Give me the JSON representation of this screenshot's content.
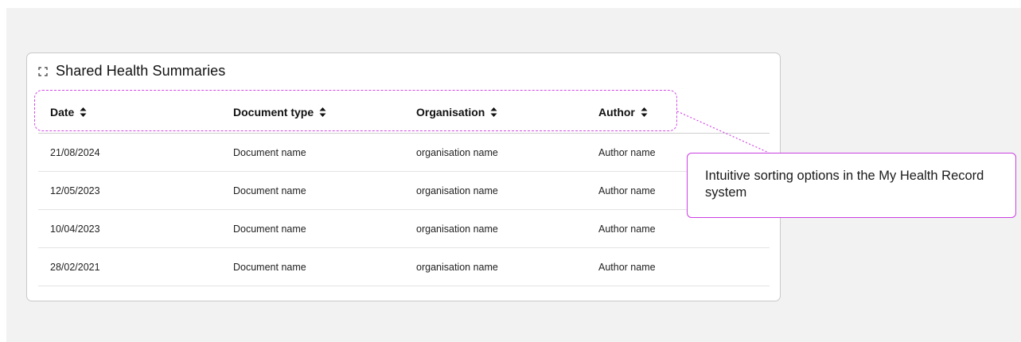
{
  "card": {
    "title": "Shared Health Summaries",
    "icon": "expand-icon"
  },
  "table": {
    "headers": [
      {
        "label": "Date",
        "icon": "sort-icon"
      },
      {
        "label": "Document type",
        "icon": "sort-icon"
      },
      {
        "label": "Organisation",
        "icon": "sort-icon"
      },
      {
        "label": "Author",
        "icon": "sort-icon"
      }
    ],
    "rows": [
      [
        "21/08/2024",
        "Document name",
        "organisation name",
        "Author name"
      ],
      [
        "12/05/2023",
        "Document name",
        "organisation name",
        "Author name"
      ],
      [
        "10/04/2023",
        "Document name",
        "organisation name",
        "Author name"
      ],
      [
        "28/02/2021",
        "Document name",
        "organisation name",
        "Author name"
      ]
    ]
  },
  "annotation": {
    "text": "Intuitive sorting options in the My Health Record system",
    "accent_color": "#cc3fe3"
  }
}
